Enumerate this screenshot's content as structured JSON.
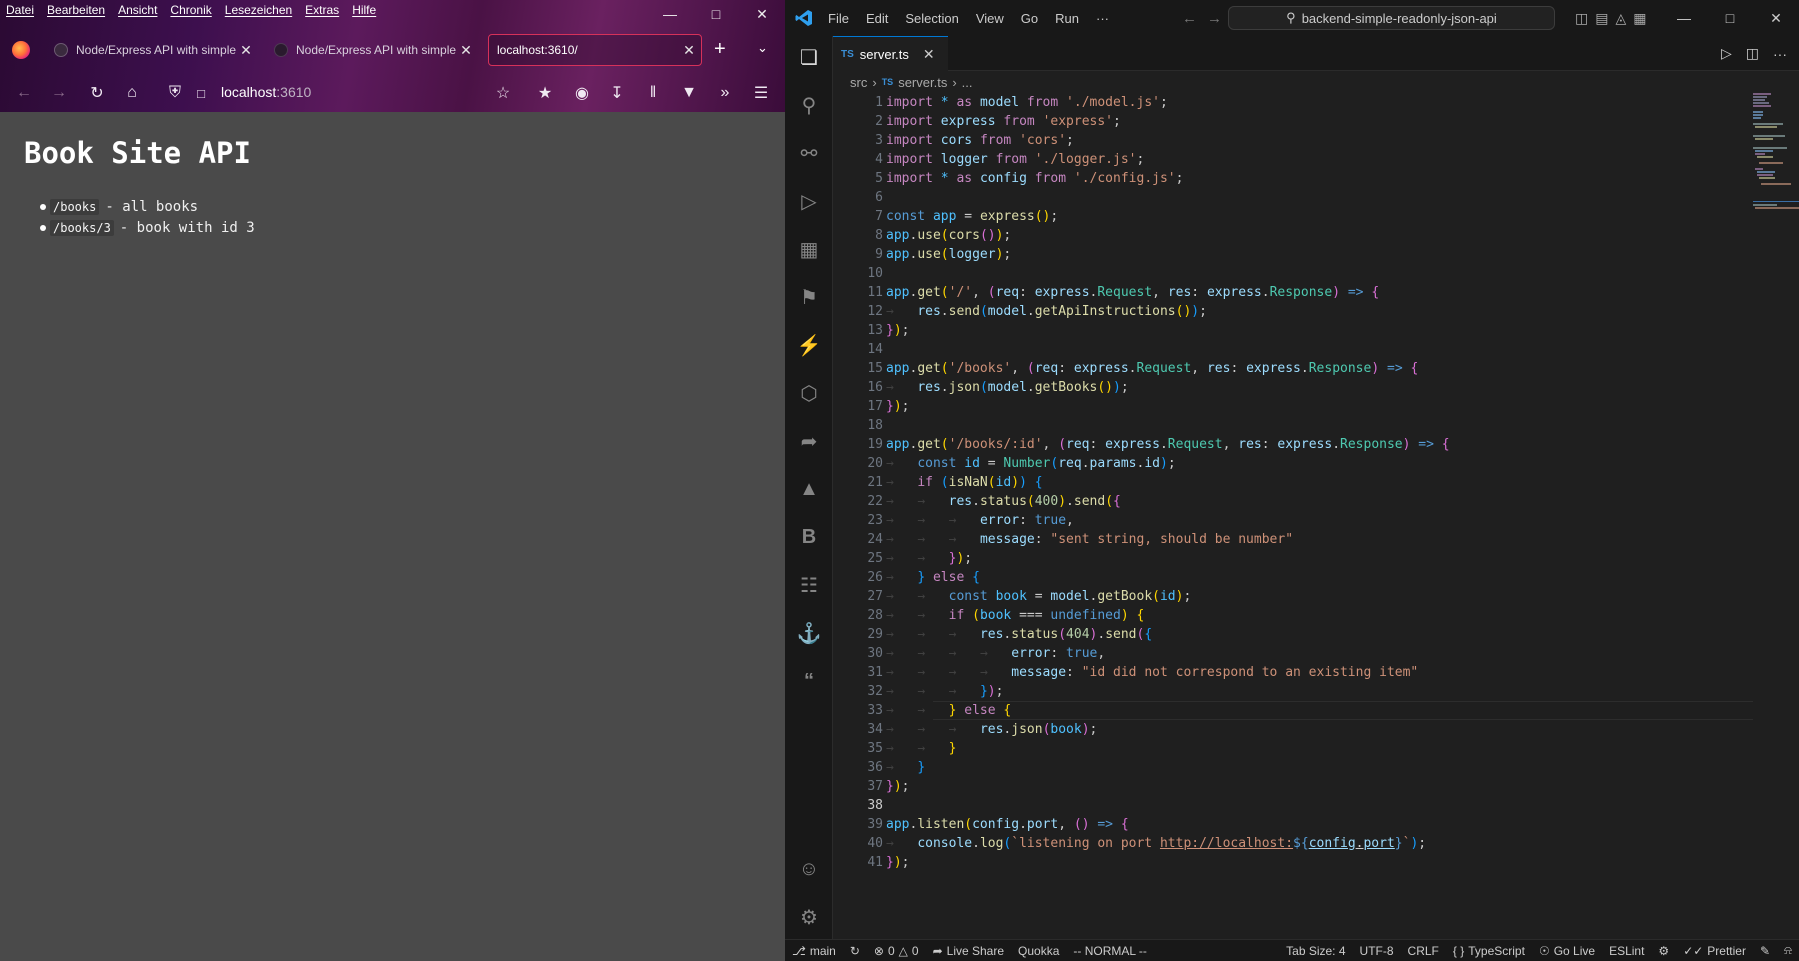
{
  "firefox": {
    "menu": [
      "Datei",
      "Bearbeiten",
      "Ansicht",
      "Chronik",
      "Lesezeichen",
      "Extras",
      "Hilfe"
    ],
    "tabs": [
      {
        "title": "Node/Express API with simple"
      },
      {
        "title": "Node/Express API with simple"
      },
      {
        "title": "localhost:3610/"
      }
    ],
    "url": {
      "host": "localhost",
      "port": ":3610"
    },
    "page": {
      "title": "Book Site API",
      "items": [
        {
          "code": "/books",
          "desc": "- all books"
        },
        {
          "code": "/books/3",
          "desc": "- book with id 3"
        }
      ]
    }
  },
  "vscode": {
    "menu": [
      "File",
      "Edit",
      "Selection",
      "View",
      "Go",
      "Run",
      "···"
    ],
    "search": "backend-simple-readonly-json-api",
    "tab": {
      "badge": "TS",
      "name": "server.ts"
    },
    "breadcrumb": {
      "folder": "src",
      "badge": "TS",
      "file": "server.ts",
      "more": "..."
    },
    "line_numbers": [
      "1",
      "2",
      "3",
      "4",
      "5",
      "6",
      "7",
      "8",
      "9",
      "10",
      "11",
      "12",
      "13",
      "14",
      "15",
      "16",
      "17",
      "18",
      "19",
      "20",
      "21",
      "22",
      "23",
      "24",
      "25",
      "26",
      "27",
      "28",
      "29",
      "30",
      "31",
      "32",
      "33",
      "34",
      "35",
      "36",
      "37",
      "38",
      "39",
      "40",
      "41"
    ],
    "status": {
      "branch": "main",
      "errors": "0",
      "warnings": "0",
      "live_share": "Live Share",
      "quokka": "Quokka",
      "mode": "-- NORMAL --",
      "tab_size": "Tab Size: 4",
      "encoding": "UTF-8",
      "eol": "CRLF",
      "language": "TypeScript",
      "go_live": "Go Live",
      "eslint": "ESLint",
      "prettier": "Prettier"
    }
  },
  "colors": {
    "accent": "#0078d4",
    "keyword": "#c586c0",
    "string": "#ce9178",
    "function": "#dcdcaa",
    "variable": "#9cdcfe"
  }
}
